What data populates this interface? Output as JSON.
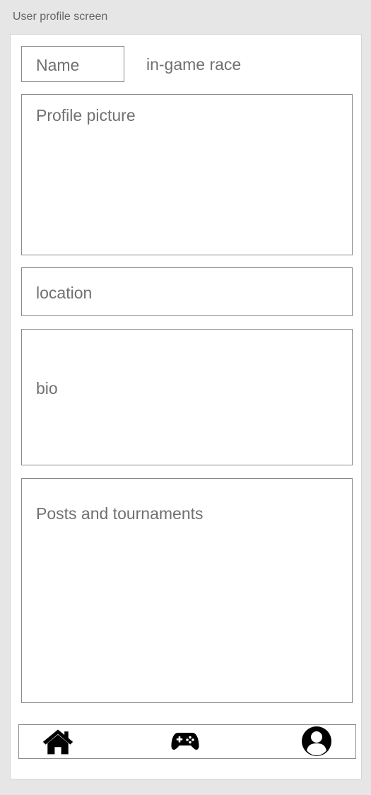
{
  "frame": {
    "title": "User profile screen"
  },
  "profile": {
    "name_label": "Name",
    "race_label": "in-game race",
    "picture_label": "Profile picture",
    "location_label": "location",
    "bio_label": "bio",
    "posts_label": "Posts and tournaments"
  },
  "navbar": {
    "items": [
      {
        "icon": "home-icon"
      },
      {
        "icon": "gamepad-icon"
      },
      {
        "icon": "user-profile-icon"
      }
    ]
  },
  "colors": {
    "background": "#e6e6e6",
    "screen": "#ffffff",
    "border": "#8a8a8a",
    "label_text": "#707070",
    "icon": "#000000"
  }
}
